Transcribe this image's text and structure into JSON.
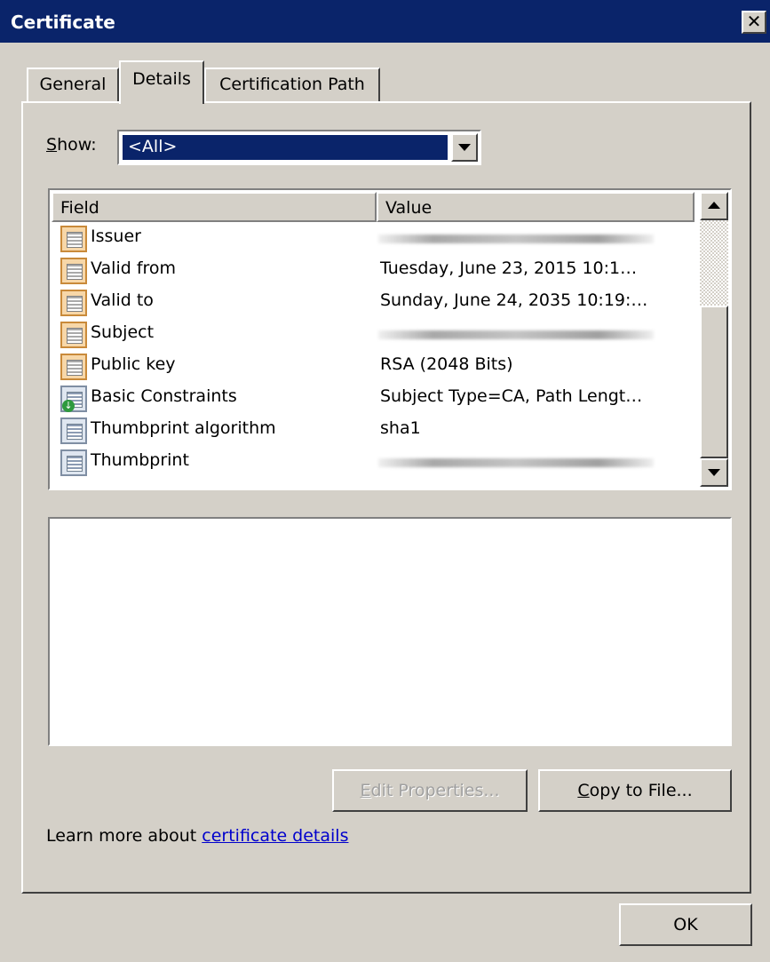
{
  "window": {
    "title": "Certificate",
    "close_glyph": "✕"
  },
  "tabs": [
    {
      "label": "General"
    },
    {
      "label": "Details"
    },
    {
      "label": "Certification Path"
    }
  ],
  "show": {
    "label_accel": "S",
    "label_rest": "how:",
    "selected": "<All>"
  },
  "list": {
    "columns": {
      "field": "Field",
      "value": "Value"
    },
    "rows": [
      {
        "field": "Issuer",
        "value": "",
        "blurred": true,
        "icon": "certificate-field-icon"
      },
      {
        "field": "Valid from",
        "value": "Tuesday, June 23, 2015 10:1…",
        "icon": "certificate-field-icon"
      },
      {
        "field": "Valid to",
        "value": "Sunday, June 24, 2035 10:19:…",
        "icon": "certificate-field-icon"
      },
      {
        "field": "Subject",
        "value": "",
        "blurred": true,
        "icon": "certificate-field-icon"
      },
      {
        "field": "Public key",
        "value": "RSA (2048 Bits)",
        "icon": "certificate-field-icon"
      },
      {
        "field": "Basic Constraints",
        "value": "Subject Type=CA, Path Lengt…",
        "icon": "critical-extension-icon"
      },
      {
        "field": "Thumbprint algorithm",
        "value": "sha1",
        "icon": "property-icon"
      },
      {
        "field": "Thumbprint",
        "value": "",
        "blurred": true,
        "icon": "property-icon"
      }
    ]
  },
  "detail_text": "",
  "buttons": {
    "edit_accel": "E",
    "edit_rest": "dit Properties...",
    "copy_accel": "C",
    "copy_rest": "opy to File...",
    "ok": "OK"
  },
  "learn_more": {
    "prefix": "Learn more about ",
    "link": "certificate details"
  },
  "colors": {
    "titlebar": "#0a246a",
    "face": "#d4d0c8",
    "selection": "#0a246a",
    "link": "#0000cc"
  }
}
